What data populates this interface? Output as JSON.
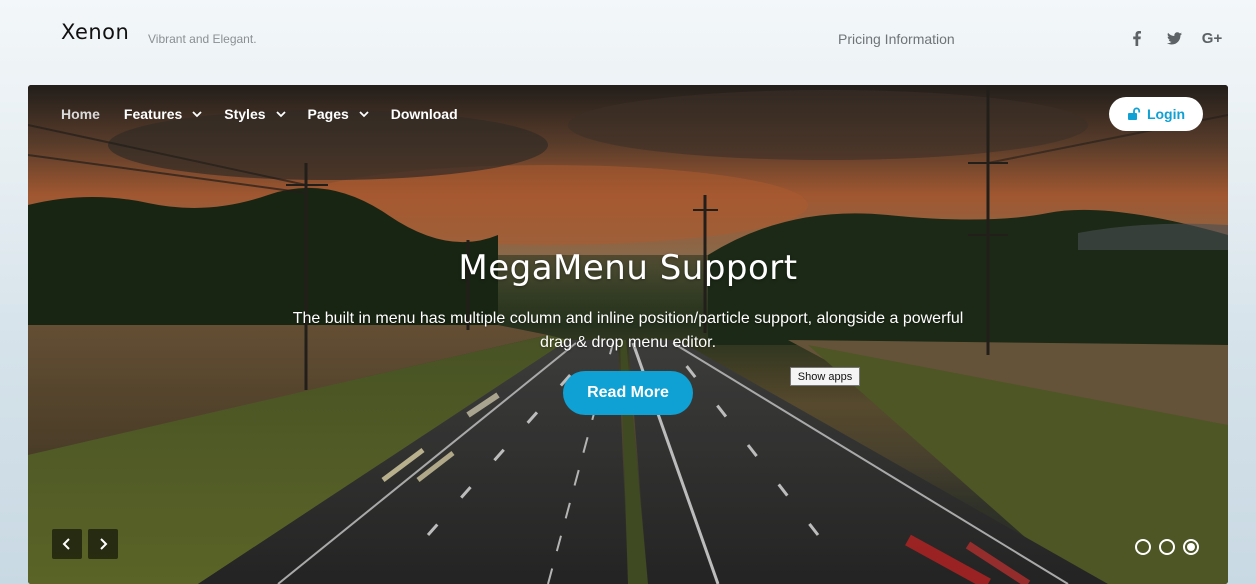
{
  "site": {
    "logo": "Xenon",
    "tagline": "Vibrant and Elegant."
  },
  "header": {
    "pricing_link": "Pricing Information",
    "social": [
      {
        "icon": "facebook-icon",
        "label": "f"
      },
      {
        "icon": "twitter-icon",
        "label": "t"
      },
      {
        "icon": "google-plus-icon",
        "label": "G+"
      }
    ]
  },
  "nav": {
    "items": [
      {
        "label": "Home",
        "active": true,
        "dropdown": false
      },
      {
        "label": "Features",
        "active": false,
        "dropdown": true
      },
      {
        "label": "Styles",
        "active": false,
        "dropdown": true
      },
      {
        "label": "Pages",
        "active": false,
        "dropdown": true
      },
      {
        "label": "Download",
        "active": false,
        "dropdown": false
      }
    ],
    "login_label": "Login"
  },
  "slide": {
    "title": "MegaMenu Support",
    "description_line1": "The built in menu has multiple column and inline position/particle support, alongside a powerful",
    "description_line2": "drag & drop menu editor.",
    "button_label": "Read More",
    "total_slides": 3,
    "active_slide": 3
  },
  "tooltip": {
    "text": "Show apps"
  },
  "colors": {
    "accent": "#0fa0d4",
    "text_dark": "#111111",
    "muted": "#8a8f93"
  }
}
